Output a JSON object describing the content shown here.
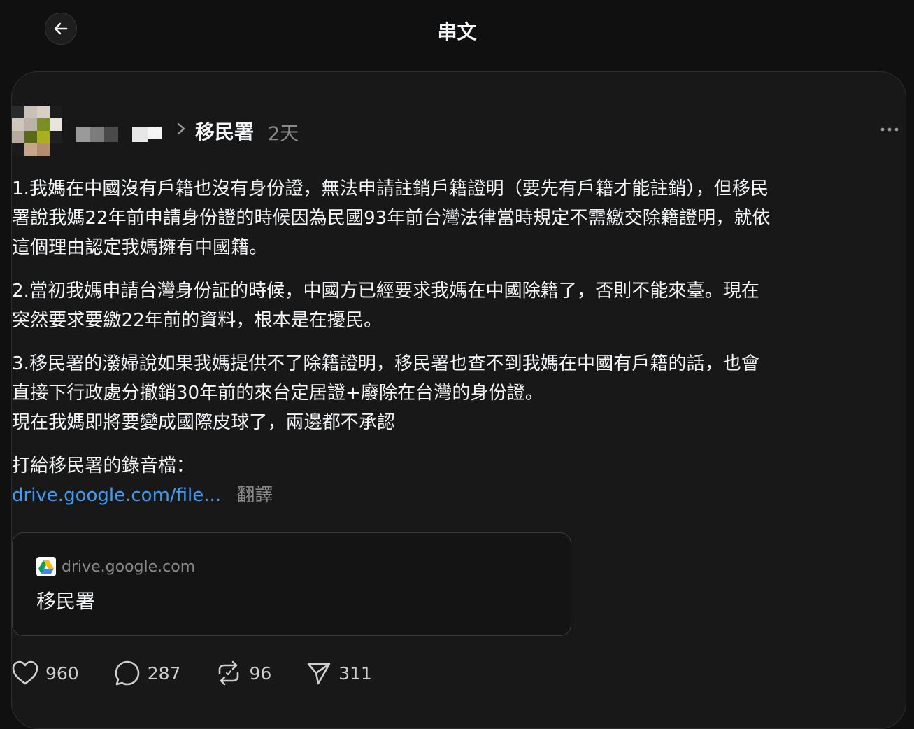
{
  "header": {
    "title": "串文"
  },
  "post": {
    "community": "移民署",
    "time": "2天",
    "paragraphs": [
      "1.我媽在中國沒有戶籍也沒有身份證，無法申請註銷戶籍證明（要先有戶籍才能註銷），但移民\n署說我媽22年前申請身份證的時候因為民國93年前台灣法律當時規定不需繳交除籍證明，就依\n這個理由認定我媽擁有中國籍。",
      "2.當初我媽申請台灣身份証的時候，中國方已經要求我媽在中國除籍了，否則不能來臺。現在\n突然要求要繳22年前的資料，根本是在擾民。",
      "3.移民署的潑婦說如果我媽提供不了除籍證明，移民署也查不到我媽在中國有戶籍的話，也會\n直接下行政處分撤銷30年前的來台定居證+廢除在台灣的身份證。\n現在我媽即將要變成國際皮球了，兩邊都不承認",
      "打給移民署的錄音檔："
    ],
    "link_text": "drive.google.com/file...",
    "translate_label": "翻譯",
    "preview": {
      "domain": "drive.google.com",
      "title": "移民署"
    },
    "actions": {
      "likes": "960",
      "comments": "287",
      "reposts": "96",
      "shares": "311"
    }
  },
  "icons": {
    "back": "arrow-left-icon",
    "chevron": "chevron-right-icon",
    "more": "more-horizontal-icon",
    "drive": "google-drive-icon",
    "like": "heart-icon",
    "comment": "comment-bubble-icon",
    "repost": "repost-icon",
    "share": "paper-plane-icon"
  },
  "colors": {
    "background": "#101010",
    "card": "#181818",
    "link": "#3f9cf6",
    "muted": "#8a8a8a"
  }
}
